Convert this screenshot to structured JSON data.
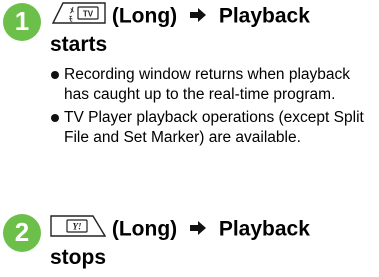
{
  "steps": [
    {
      "number": "1",
      "key_icon": "tv-memo-key-icon",
      "key_press": "(Long)",
      "result_line1": "Playback",
      "result_line2": "starts",
      "notes": [
        "Recording window returns when playback has caught up to the real-time program.",
        "TV Player playback operations (except Split File and Set Marker) are available."
      ]
    },
    {
      "number": "2",
      "key_icon": "y-key-icon",
      "key_press": "(Long)",
      "result_line1": "Playback",
      "result_line2": "stops"
    }
  ],
  "colors": {
    "badge": "#6cc04a",
    "badge_dark": "#3f8f2a",
    "icon_stroke": "#222222"
  }
}
